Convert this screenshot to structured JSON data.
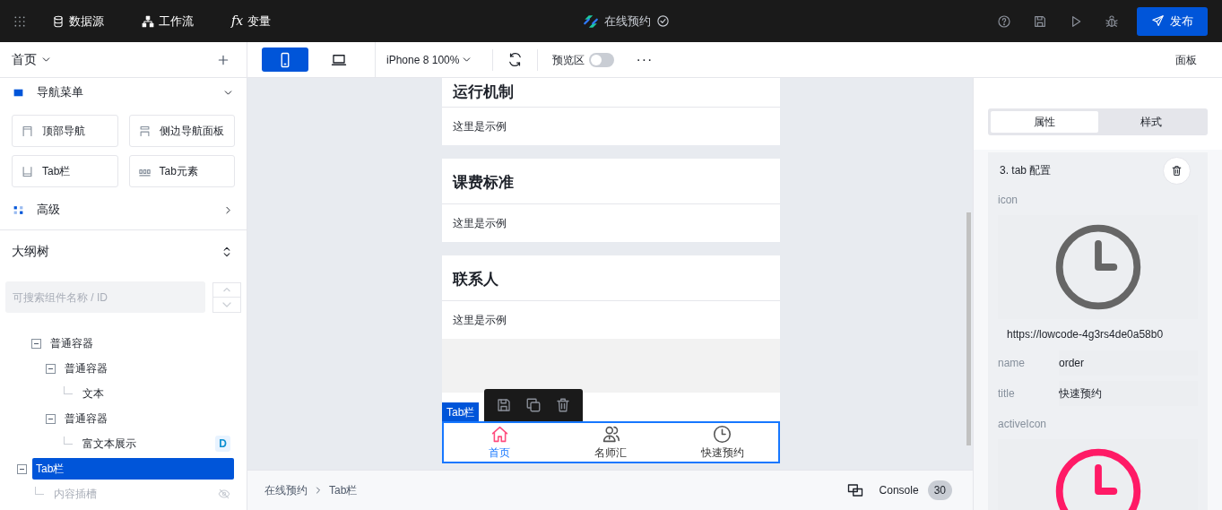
{
  "top_bar": {
    "menus": [
      {
        "kind": "database",
        "label": "数据源"
      },
      {
        "kind": "flow",
        "label": "工作流"
      },
      {
        "kind": "fx",
        "glyph": "fx",
        "label": "变量"
      }
    ],
    "app_title": "在线预约",
    "publish_button": "发布"
  },
  "toolbar": {
    "page": "首页",
    "devices": [
      {
        "kind": "phone",
        "selected": true
      },
      {
        "kind": "laptop",
        "selected": false
      }
    ],
    "device_preset": "iPhone 8 100%",
    "preview": {
      "label": "预览区",
      "on": false
    },
    "more": "···",
    "panel": "面板"
  },
  "components": {
    "sections": [
      {
        "kind": "nav",
        "title": "导航菜单",
        "expanded": true,
        "items": [
          {
            "kind": "top",
            "label": "顶部导航"
          },
          {
            "kind": "side",
            "label": "侧边导航面板"
          },
          {
            "kind": "tabbar",
            "label": "Tab栏"
          },
          {
            "kind": "tabitem",
            "label": "Tab元素"
          }
        ]
      },
      {
        "kind": "advanced",
        "title": "高级",
        "expanded": false
      }
    ]
  },
  "outline": {
    "title": "大纲树",
    "search": {
      "placeholder": "可搜索组件名称 / ID"
    },
    "tree": [
      {
        "children": [
          {
            "label": "普通容器",
            "expanded": true,
            "selected": false,
            "children": [
              {
                "label": "普通容器",
                "expanded": true,
                "selected": false,
                "children": [
                  {
                    "label": "文本",
                    "selected": false
                  }
                ]
              },
              {
                "label": "普通容器",
                "expanded": true,
                "selected": false,
                "children": [
                  {
                    "label": "富文本展示",
                    "badge": "D",
                    "selected": false
                  }
                ]
              }
            ]
          }
        ]
      },
      {
        "label": "Tab栏",
        "expanded": true,
        "selected": true,
        "children": [
          {
            "label": "内容插槽",
            "hidden": true,
            "selected": false
          }
        ]
      }
    ]
  },
  "canvas": {
    "cards": [
      {
        "title": "运行机制",
        "body": "这里是示例"
      },
      {
        "title": "课费标准",
        "body": "这里是示例"
      },
      {
        "title": "联系人",
        "body": "这里是示例"
      }
    ],
    "selection_label": "Tab栏",
    "tabbar": [
      {
        "kind": "home",
        "label": "首页",
        "selected": true
      },
      {
        "kind": "people",
        "label": "名师汇",
        "selected": false
      },
      {
        "kind": "clock",
        "label": "快速预约",
        "selected": false
      }
    ],
    "breadcrumb": [
      "在线预约",
      "Tab栏"
    ],
    "console": {
      "label": "Console",
      "count": "30"
    }
  },
  "inspector": {
    "tabs": [
      {
        "label": "属性",
        "selected": true
      },
      {
        "label": "样式",
        "selected": false
      }
    ],
    "section_title": "3. tab 配置",
    "fields": [
      {
        "kind": "icon",
        "label": "icon",
        "color": "#666666",
        "url": "https://lowcode-4g3rs4de0a58b0"
      },
      {
        "kind": "text",
        "label": "name",
        "value": "order"
      },
      {
        "kind": "text",
        "label": "title",
        "value": "快速预约"
      },
      {
        "kind": "icon",
        "label": "activeIcon",
        "color": "#ff1a66"
      }
    ]
  }
}
